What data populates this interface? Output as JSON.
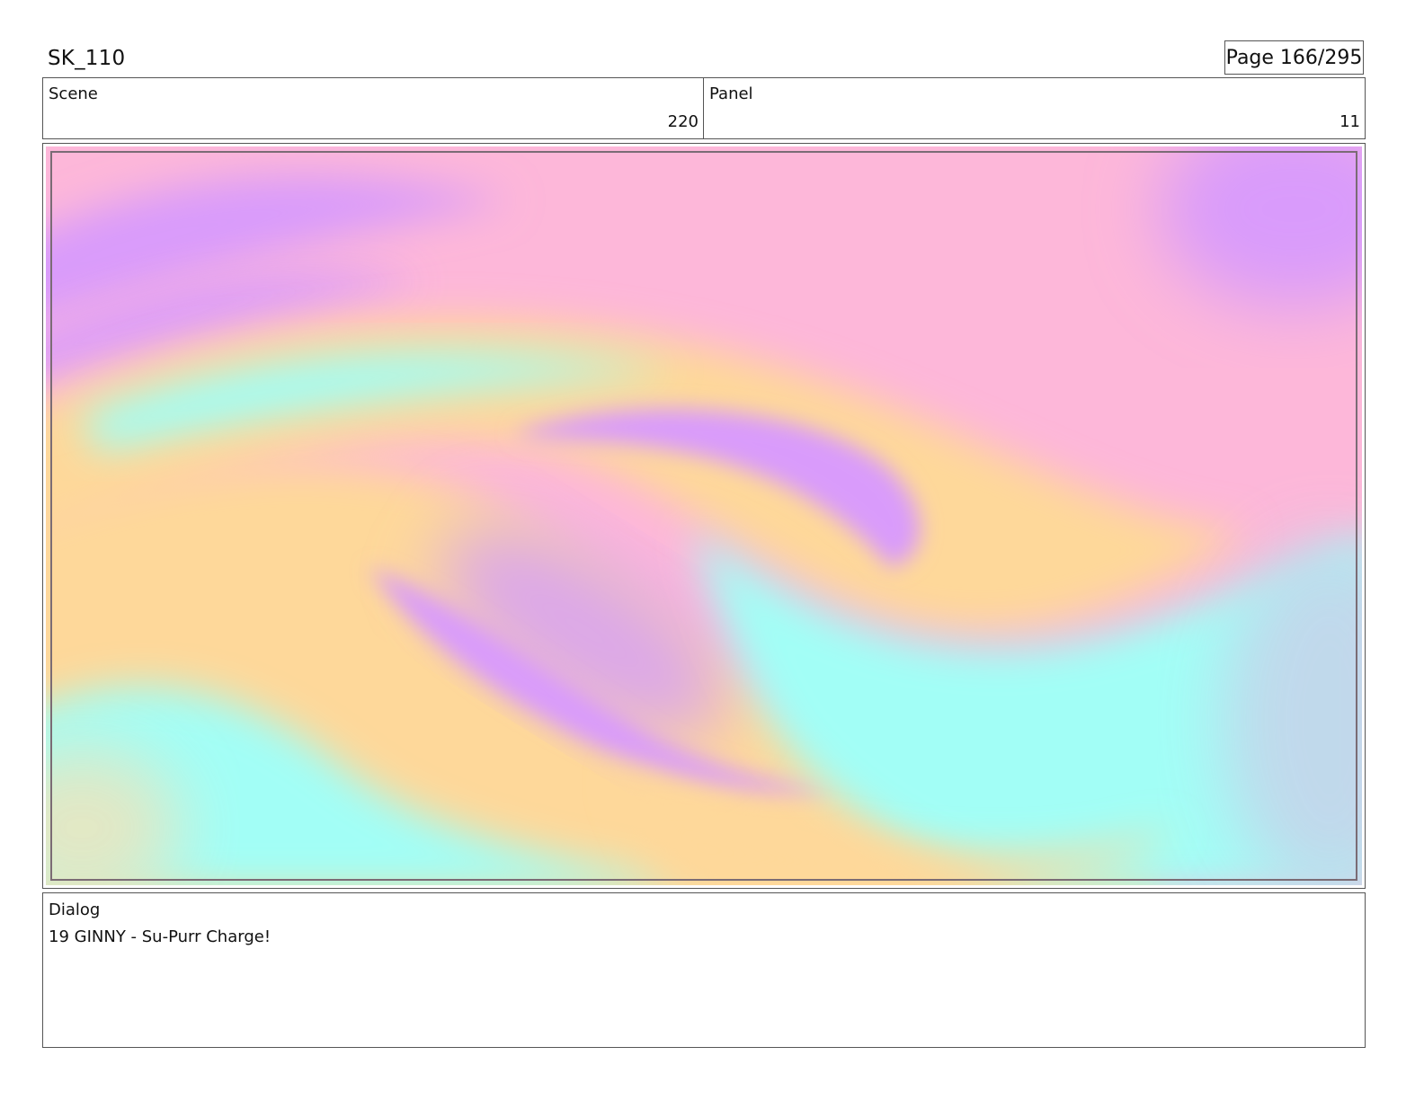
{
  "header": {
    "doc_id": "SK_110",
    "page": "Page 166/295"
  },
  "info": {
    "scene_label": "Scene",
    "scene_value": "220",
    "panel_label": "Panel",
    "panel_value": "11"
  },
  "dialog": {
    "label": "Dialog",
    "text": "19 GINNY - Su-Purr Charge!"
  },
  "colors": {
    "pink": "#fdb7d9",
    "purple": "#d99bfb",
    "peach": "#fed89a",
    "cyan": "#a2fef6",
    "frame_border": "#555555"
  }
}
